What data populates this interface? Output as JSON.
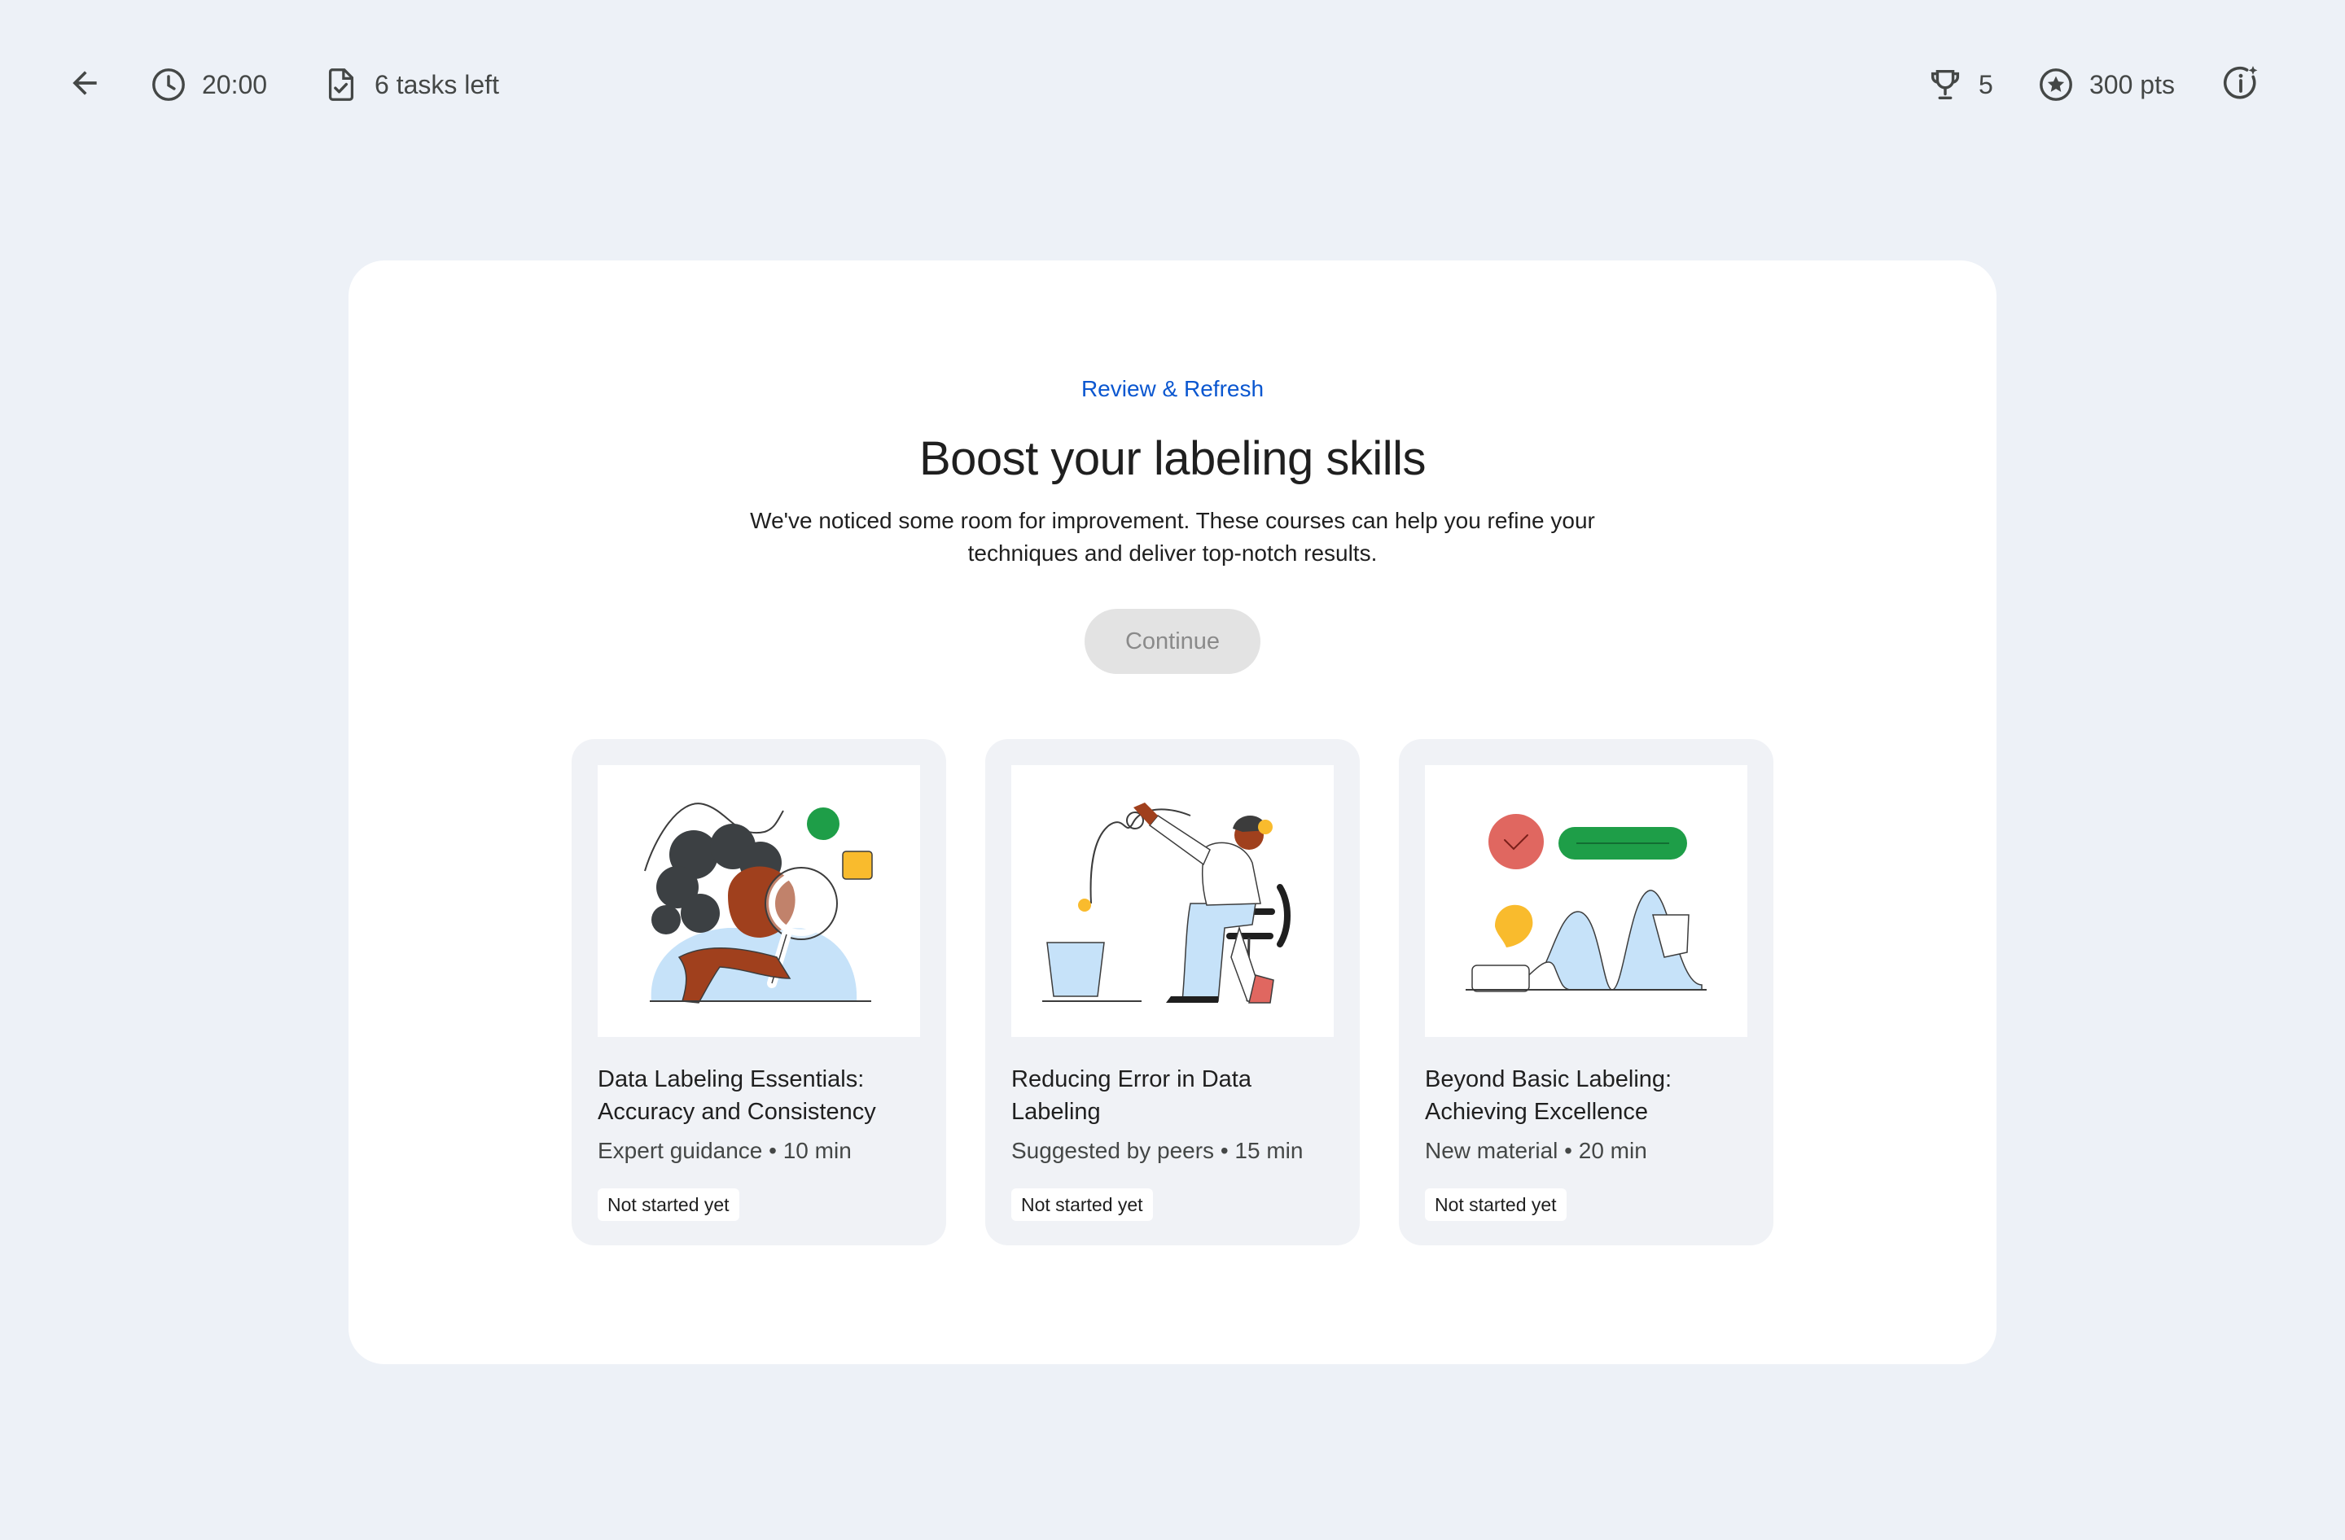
{
  "topbar": {
    "timer": "20:00",
    "tasks_left": "6 tasks left",
    "trophies": "5",
    "points": "300 pts"
  },
  "icons": {
    "back": "arrow-back-icon",
    "timer": "clock-icon",
    "tasks": "task-checklist-icon",
    "trophy": "trophy-icon",
    "points": "star-circle-icon",
    "info": "info-sparkle-icon"
  },
  "hero": {
    "eyebrow": "Review & Refresh",
    "title": "Boost your labeling skills",
    "subtitle": "We've noticed some room for improvement. These courses can help you refine your techniques and deliver top-notch results.",
    "continue_label": "Continue"
  },
  "courses": [
    {
      "title": "Data Labeling Essentials: Accuracy and Consistency",
      "meta": "Expert guidance • 10 min",
      "status": "Not started yet"
    },
    {
      "title": "Reducing Error in Data Labeling",
      "meta": "Suggested by peers • 15 min",
      "status": "Not started yet"
    },
    {
      "title": "Beyond Basic Labeling: Achieving Excellence",
      "meta": "New material • 20 min",
      "status": "Not started yet"
    }
  ],
  "colors": {
    "page_bg": "#edf1f7",
    "card_bg": "#ffffff",
    "accent_blue": "#0b57d0",
    "course_card_bg": "#f0f2f6",
    "disabled_button_bg": "#e3e3e3",
    "illustration_green": "#1e9e48",
    "illustration_yellow": "#f9bb2d",
    "illustration_red": "#e06760",
    "illustration_light_blue": "#c6e2f9"
  }
}
